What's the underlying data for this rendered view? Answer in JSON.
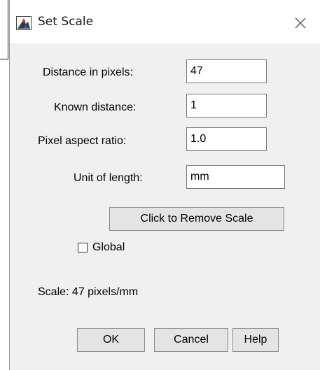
{
  "window": {
    "title": "Set Scale"
  },
  "icons": {
    "app": "imagej-app-icon",
    "close": "close-icon"
  },
  "form": {
    "distance_label": "Distance in pixels:",
    "distance_value": "47",
    "known_label": "Known distance:",
    "known_value": "1",
    "aspect_label": "Pixel aspect ratio:",
    "aspect_value": "1.0",
    "unit_label": "Unit of length:",
    "unit_value": "mm"
  },
  "remove_scale_label": "Click to Remove Scale",
  "global": {
    "label": "Global",
    "checked": false
  },
  "scale_text": "Scale: 47 pixels/mm",
  "buttons": {
    "ok": "OK",
    "cancel": "Cancel",
    "help": "Help"
  }
}
